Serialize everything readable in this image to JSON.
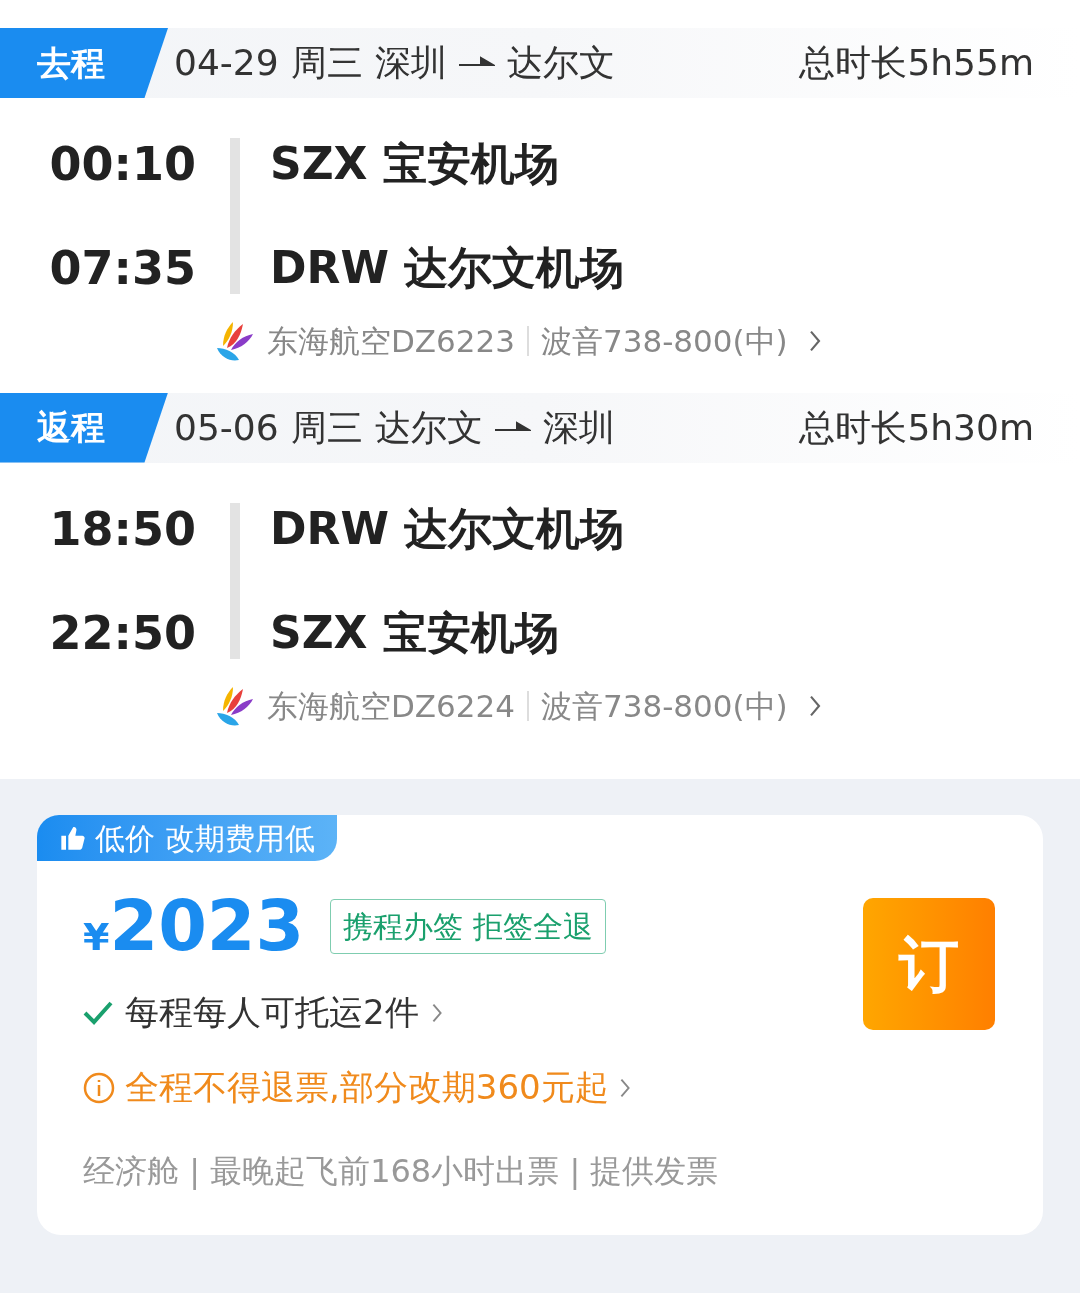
{
  "legs": [
    {
      "label": "去程",
      "date": "04-29",
      "weekday": "周三",
      "from": "深圳",
      "to": "达尔文",
      "duration": "总时长5h55m",
      "departure": {
        "time": "00:10",
        "airport": "SZX 宝安机场"
      },
      "arrival": {
        "time": "07:35",
        "airport": "DRW 达尔文机场"
      },
      "airline": "东海航空DZ6223",
      "aircraft": "波音738-800(中)"
    },
    {
      "label": "返程",
      "date": "05-06",
      "weekday": "周三",
      "from": "达尔文",
      "to": "深圳",
      "duration": "总时长5h30m",
      "departure": {
        "time": "18:50",
        "airport": "DRW 达尔文机场"
      },
      "arrival": {
        "time": "22:50",
        "airport": "SZX 宝安机场"
      },
      "airline": "东海航空DZ6224",
      "aircraft": "波音738-800(中)"
    }
  ],
  "offer": {
    "tag": "低价 改期费用低",
    "currency": "¥",
    "price": "2023",
    "badge": "携程办签 拒签全退",
    "baggage": "每程每人可托运2件",
    "refund_note": "全程不得退票,部分改期360元起",
    "details": "经济舱 | 最晚起飞前168小时出票 | 提供发票",
    "book_button": "订"
  }
}
